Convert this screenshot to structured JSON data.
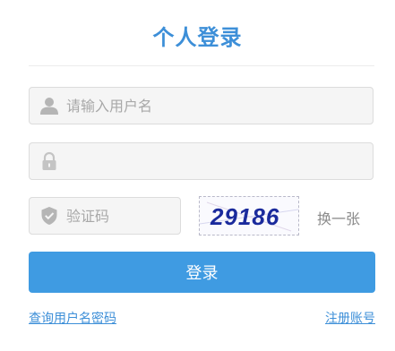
{
  "title": "个人登录",
  "username": {
    "placeholder": "请输入用户名",
    "value": ""
  },
  "password": {
    "placeholder": "",
    "value": ""
  },
  "captcha": {
    "placeholder": "验证码",
    "value": "",
    "image_text": "29186",
    "refresh_label": "换一张"
  },
  "login_button": "登录",
  "links": {
    "forgot": "查询用户名密码",
    "register": "注册账号"
  },
  "colors": {
    "accent": "#3f9be2",
    "title": "#3d8fd8",
    "icon": "#b5b5b5",
    "captcha_text": "#1a2a9c"
  }
}
